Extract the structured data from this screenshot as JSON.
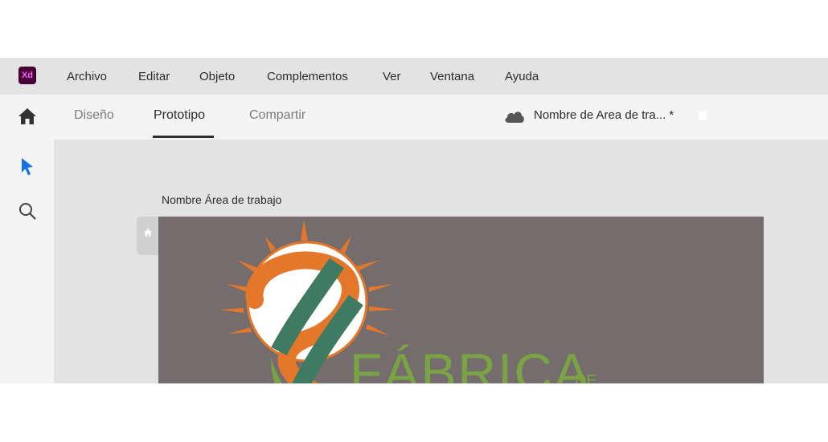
{
  "app": {
    "logo_text": "Xd",
    "colors": {
      "logo_bg": "#470137",
      "logo_fg": "#ff61f6",
      "select_tool": "#1473e6",
      "artboard_bg": "#756d6d"
    }
  },
  "menubar": {
    "items": [
      "Archivo",
      "Editar",
      "Objeto",
      "Complementos",
      "Ver",
      "Ventana",
      "Ayuda"
    ]
  },
  "modebar": {
    "home_icon": "home-icon",
    "tabs": [
      {
        "label": "Diseño",
        "active": false
      },
      {
        "label": "Prototipo",
        "active": true
      },
      {
        "label": "Compartir",
        "active": false
      }
    ],
    "cloud_icon": "cloud-icon",
    "document_name": "Nombre de Area de tra... *"
  },
  "toolbar": {
    "tools": [
      {
        "icon": "select-arrow-icon",
        "active": true
      },
      {
        "icon": "zoom-icon",
        "active": false
      }
    ]
  },
  "canvas": {
    "artboard_title": "Nombre Área de trabajo",
    "home_marker_icon": "home-icon",
    "logo": {
      "text": "FÁBRICA",
      "suffix": "DE",
      "colors": {
        "rays": "#e5772b",
        "circle": "#ffffff",
        "ribbon_green": "#3f7a63",
        "ribbon_orange": "#e5772b",
        "text": "#7aa443"
      }
    }
  }
}
